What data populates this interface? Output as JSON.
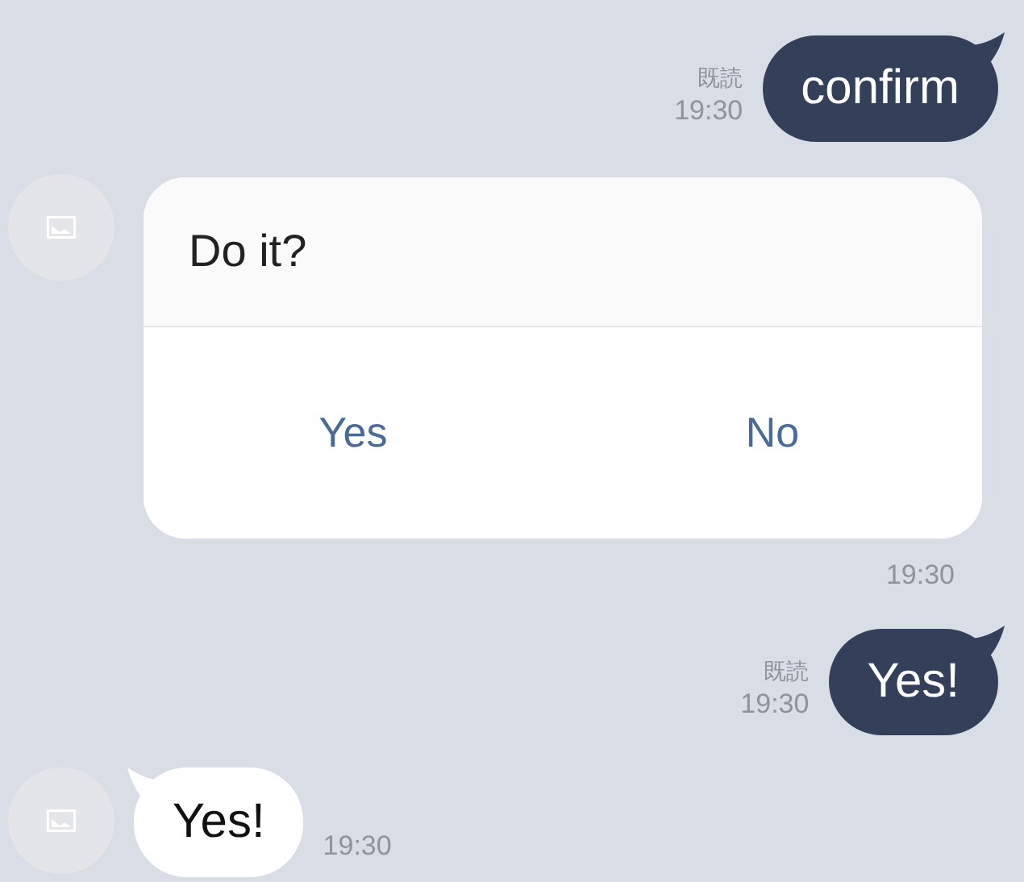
{
  "messages": [
    {
      "kind": "sent",
      "text": "confirm",
      "read": "既読",
      "time": "19:30"
    },
    {
      "kind": "confirm",
      "title": "Do it?",
      "buttons": [
        "Yes",
        "No"
      ],
      "time": "19:30"
    },
    {
      "kind": "sent",
      "text": "Yes!",
      "read": "既読",
      "time": "19:30"
    },
    {
      "kind": "received",
      "text": "Yes!",
      "time": "19:30"
    }
  ]
}
